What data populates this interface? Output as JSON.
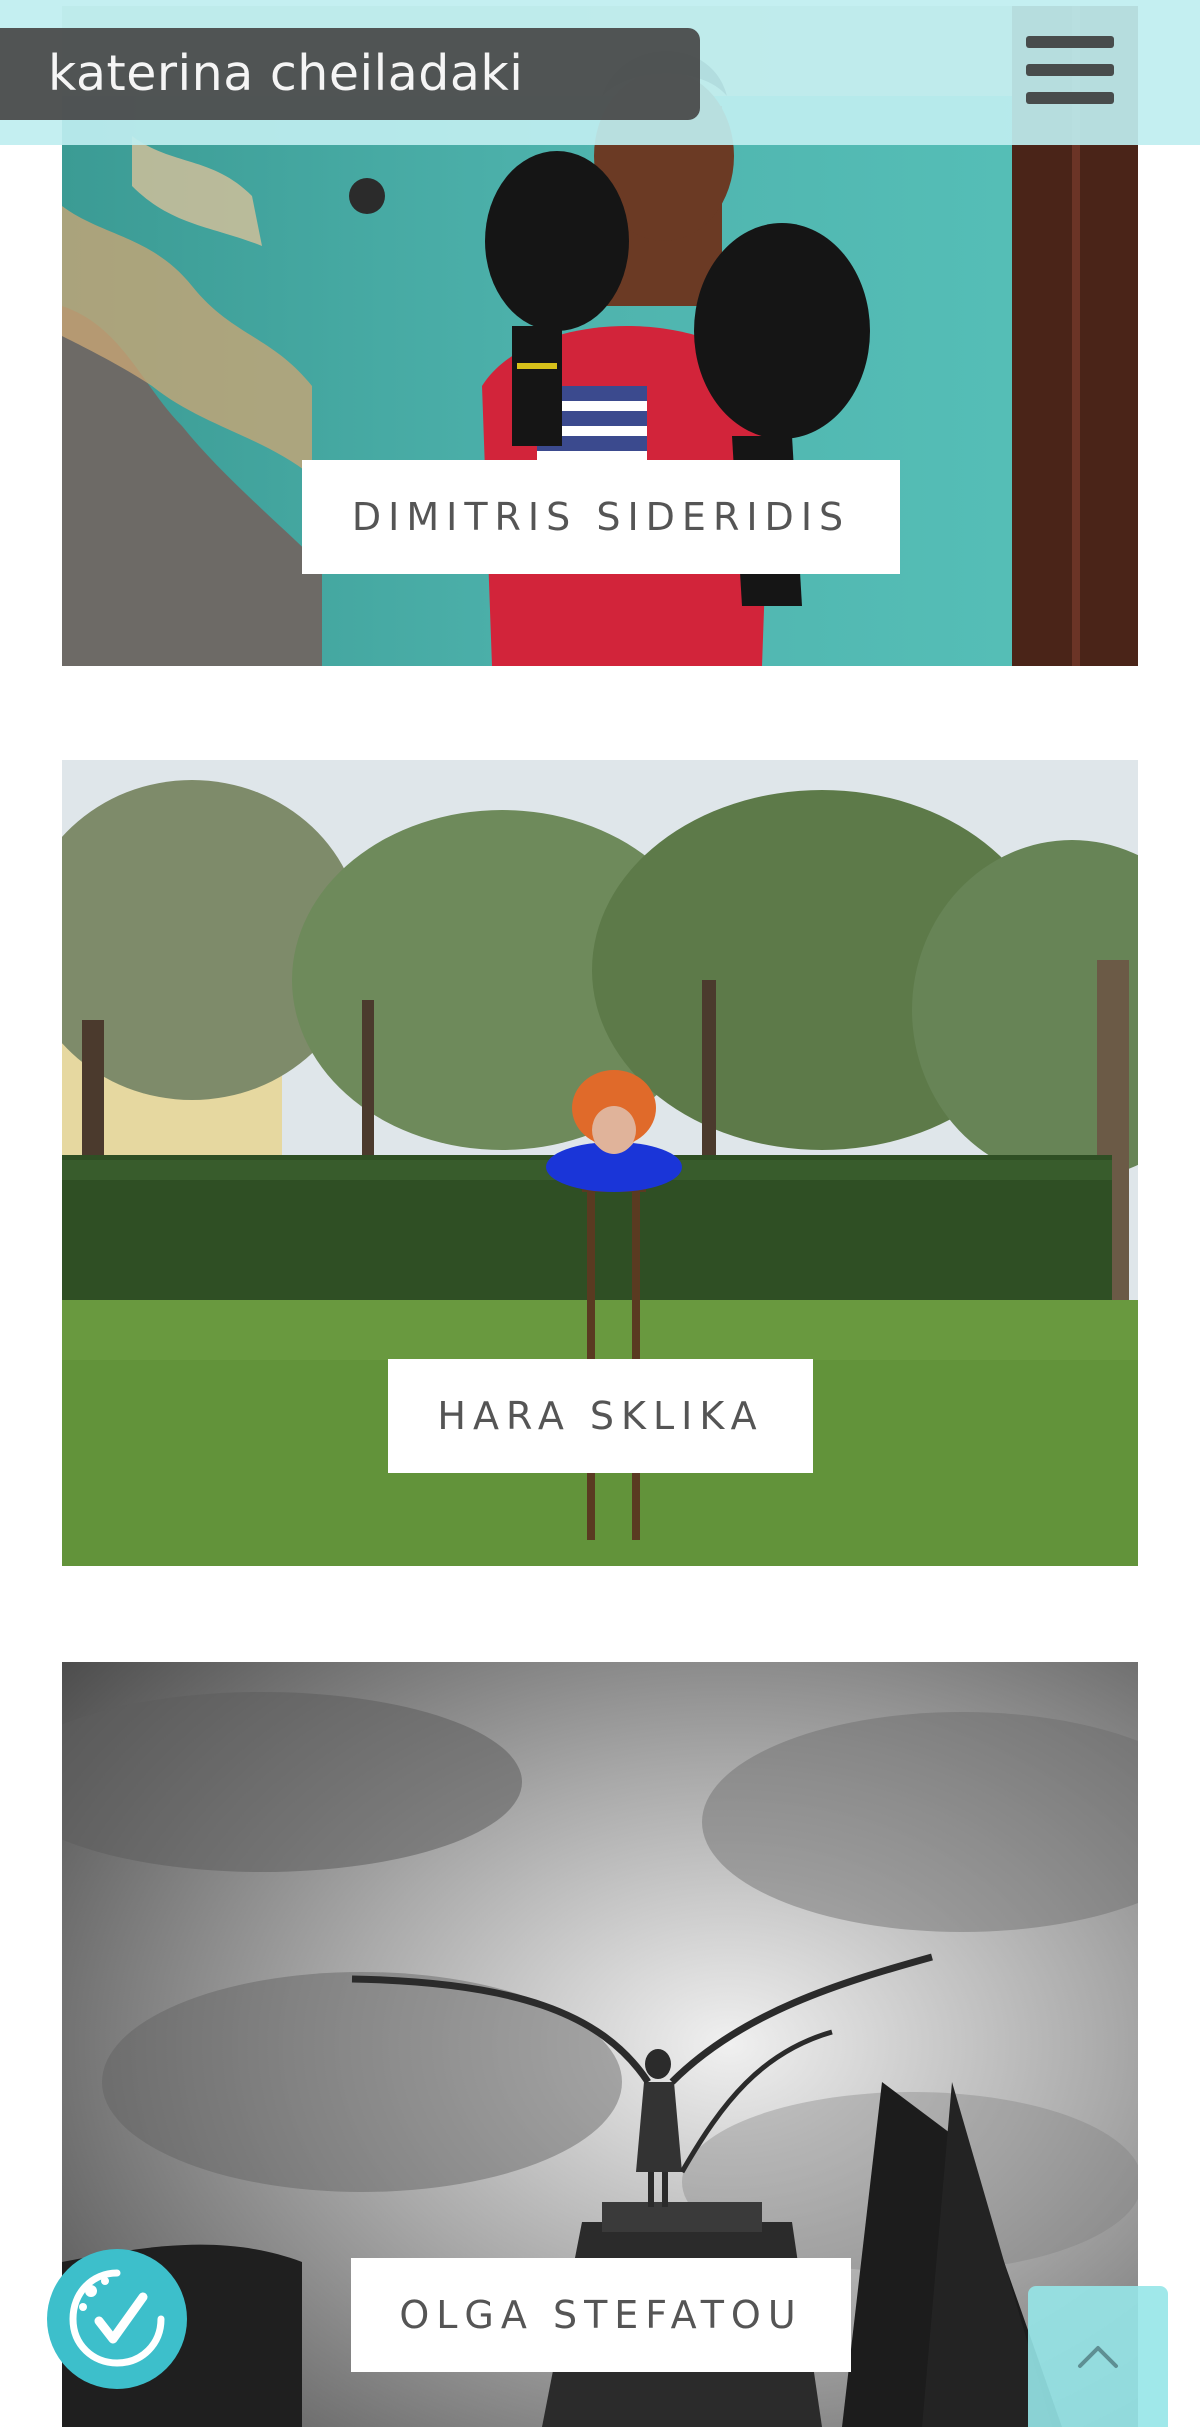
{
  "header": {
    "site_title": "katerina cheiladaki",
    "menu_icon": "hamburger-menu-icon"
  },
  "gallery": {
    "items": [
      {
        "label": "DIMITRIS SIDERIDIS"
      },
      {
        "label": "HARA SKLIKA"
      },
      {
        "label": "OLGA STEFATOU"
      }
    ]
  },
  "widgets": {
    "eco_badge_icon": "eco-check-icon",
    "scroll_top_icon": "chevron-up-icon"
  },
  "colors": {
    "header_band": "#bfeef0",
    "brand_bg": "#464646",
    "accent": "#3dbfcb",
    "label_text": "#555555"
  }
}
